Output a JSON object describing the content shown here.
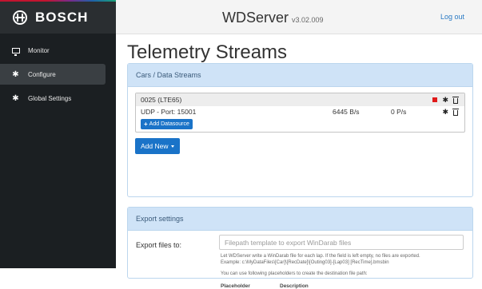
{
  "brand": {
    "name": "BOSCH"
  },
  "sidebar": {
    "items": [
      {
        "label": "Monitor",
        "icon": "monitor-icon",
        "active": false
      },
      {
        "label": "Configure",
        "icon": "gear-icon",
        "active": true
      },
      {
        "label": "Global Settings",
        "icon": "gear-icon",
        "active": false
      }
    ]
  },
  "header": {
    "title": "WDServer",
    "version": "v3.02.009",
    "logout": "Log out"
  },
  "page": {
    "title": "Telemetry Streams"
  },
  "streams_panel": {
    "heading": "Cars / Data Streams",
    "car": {
      "name": "0025 (LTE65)"
    },
    "source": {
      "label": "UDP - Port: 15001",
      "rate": "6445 B/s",
      "packets": "0 P/s"
    },
    "add_datasource": "Add Datasource",
    "add_new": "Add New"
  },
  "export_panel": {
    "heading": "Export settings",
    "label": "Export files to:",
    "placeholder": "Filepath template to export WinDarab files",
    "value": "",
    "help_line1": "Let WDServer write a WinDarab file for each lap. If the field is left empty, no files are exported.",
    "help_line2": "Example: c:\\MyDataFiles\\[Car]\\[RecDate]\\[Outing03]-[Lap03] [RecTime].bmsbin",
    "help_line3": "You can use following placeholders to create the destination file path:",
    "col_placeholder": "Placeholder",
    "col_description": "Description"
  },
  "colors": {
    "accent": "#1a73c8",
    "panel_heading": "#cfe3f7",
    "sidebar": "#1b1f22",
    "stop": "#e01a1a"
  }
}
